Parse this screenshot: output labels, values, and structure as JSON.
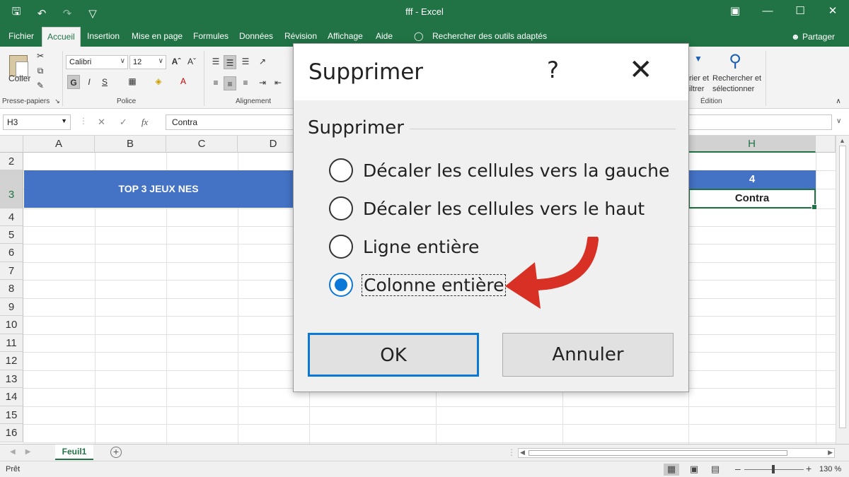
{
  "app": {
    "title": "fff  -  Excel",
    "share_label": "Partager"
  },
  "menu_tabs": [
    "Fichier",
    "Accueil",
    "Insertion",
    "Mise en page",
    "Formules",
    "Données",
    "Révision",
    "Affichage",
    "Aide"
  ],
  "active_tab": "Accueil",
  "tell_me": "Rechercher des outils adaptés",
  "ribbon": {
    "paste_label": "Coller",
    "font_name": "Calibri",
    "font_size": "12",
    "bold": "G",
    "italic": "I",
    "underline": "S",
    "groups": {
      "clipboard": "Presse-papiers",
      "font": "Police",
      "alignment": "Alignement",
      "editing": "Édition"
    },
    "sort_filter_line1": "rier et",
    "sort_filter_line2": "iltrer",
    "find_select_line1": "Rechercher et",
    "find_select_line2": "sélectionner"
  },
  "formula_bar": {
    "name_box": "H3",
    "fx": "fx",
    "content": "Contra"
  },
  "columns": [
    "A",
    "B",
    "C",
    "D",
    "H"
  ],
  "rows": [
    "2",
    "3",
    "4",
    "5",
    "6",
    "7",
    "8",
    "9",
    "10",
    "11",
    "12",
    "13",
    "14",
    "15",
    "16"
  ],
  "cells": {
    "banner": "TOP 3 JEUX NES",
    "h2": "4",
    "h3": "Contra"
  },
  "sheet_tab": "Feuil1",
  "status": {
    "ready": "Prêt",
    "zoom": "130 %"
  },
  "dialog": {
    "title": "Supprimer",
    "help": "?",
    "group_label": "Supprimer",
    "options": [
      {
        "label": "Décaler les cellules vers la gauche",
        "checked": false
      },
      {
        "label": "Décaler les cellules vers le haut",
        "checked": false
      },
      {
        "label": "Ligne entière",
        "checked": false
      },
      {
        "label": "Colonne entière",
        "checked": true
      }
    ],
    "ok_label": "OK",
    "cancel_label": "Annuler"
  },
  "colors": {
    "excel_green": "#217346",
    "header_blue": "#4472c4",
    "radio_blue": "#0a78d7",
    "arrow_red": "#d93025"
  }
}
